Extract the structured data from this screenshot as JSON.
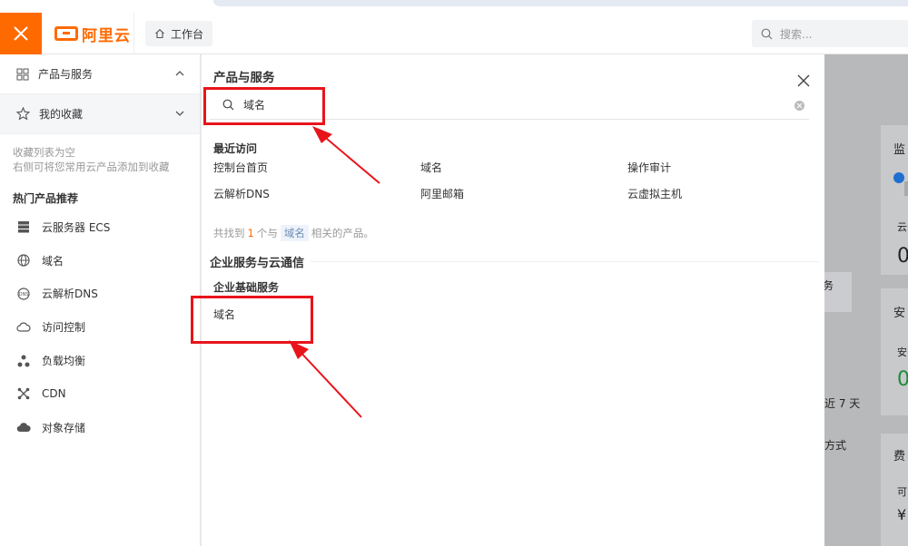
{
  "header": {
    "brand": "阿里云",
    "workbench": "工作台",
    "search_placeholder": "搜索..."
  },
  "sidebar": {
    "products_label": "产品与服务",
    "favorites_label": "我的收藏",
    "favorites_empty_line1": "收藏列表为空",
    "favorites_empty_line2": "右侧可将您常用云产品添加到收藏",
    "hot_title": "热门产品推荐",
    "hot_items": [
      {
        "label": "云服务器 ECS",
        "icon": "server-icon"
      },
      {
        "label": "域名",
        "icon": "globe-icon"
      },
      {
        "label": "云解析DNS",
        "icon": "dns-icon"
      },
      {
        "label": "访问控制",
        "icon": "cloud-lock-icon"
      },
      {
        "label": "负载均衡",
        "icon": "load-balancer-icon"
      },
      {
        "label": "CDN",
        "icon": "cdn-icon"
      },
      {
        "label": "对象存储",
        "icon": "cloud-storage-icon"
      }
    ]
  },
  "panel": {
    "title": "产品与服务",
    "search_value": "域名",
    "recent_title": "最近访问",
    "recent": [
      "控制台首页",
      "域名",
      "操作审计",
      "云解析DNS",
      "阿里邮箱",
      "云虚拟主机"
    ],
    "found_prefix": "共找到",
    "found_count": "1",
    "found_mid": "个与",
    "found_keyword": "域名",
    "found_suffix": "相关的产品。",
    "section_title": "企业服务与云通信",
    "subsection_title": "企业基础服务",
    "result": "域名"
  },
  "dashboard": {
    "card1_title": "监",
    "card2_title": "安",
    "card3_title": "费",
    "fragment_task": "务",
    "fragment_days": "近 7 天",
    "fragment_method": "方式",
    "glyph_1": "云",
    "glyph_2": "0",
    "glyph_3": "安",
    "glyph_4": "0",
    "glyph_5": "可",
    "glyph_6": "¥"
  },
  "colors": {
    "brand_orange": "#ff6a00",
    "annotation_red": "#e8141b"
  }
}
